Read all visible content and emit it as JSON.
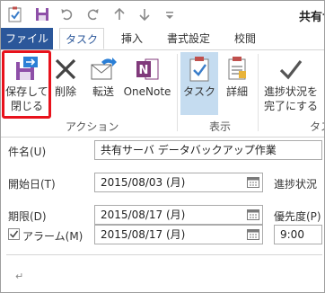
{
  "title": {
    "text": "共有サ"
  },
  "quick_access": {
    "icons": [
      "task-icon",
      "save-icon",
      "undo-icon",
      "redo-icon",
      "up-arrow-icon",
      "down-arrow-icon",
      "customize-icon"
    ]
  },
  "tabs": [
    {
      "label": "ファイル"
    },
    {
      "label": "タスク"
    },
    {
      "label": "挿入"
    },
    {
      "label": "書式設定"
    },
    {
      "label": "校閲"
    }
  ],
  "ribbon": {
    "save_close": {
      "line1": "保存して",
      "line2": "閉じる"
    },
    "delete": {
      "label": "削除"
    },
    "forward": {
      "label": "転送"
    },
    "onenote": {
      "label": "OneNote"
    },
    "task": {
      "label": "タスク"
    },
    "details": {
      "label": "詳細"
    },
    "mark_complete": {
      "line1": "進捗状況を",
      "line2": "完了にする"
    },
    "assign": {
      "line1": "タ",
      "line2": ""
    },
    "group_actions": "アクション",
    "group_show": "表示",
    "group_manage": "タス"
  },
  "form": {
    "subject": {
      "label": "件名(U)",
      "value": "共有サーバ データバックアップ作業"
    },
    "start_date": {
      "label": "開始日(T)",
      "value": "2015/08/03 (月)"
    },
    "due_date": {
      "label": "期限(D)",
      "value": "2015/08/17 (月)"
    },
    "reminder": {
      "label": "アラーム(M)",
      "checked": true,
      "date": "2015/08/17 (月)",
      "time": "9:00"
    },
    "status": {
      "label": "進捗状況"
    },
    "priority": {
      "label": "優先度(P)"
    },
    "body": {
      "paragraph_mark": "↵"
    }
  },
  "colors": {
    "file_tab": "#2b579a",
    "highlight": "#e8121c",
    "task_selected": "#c5dcf0"
  }
}
